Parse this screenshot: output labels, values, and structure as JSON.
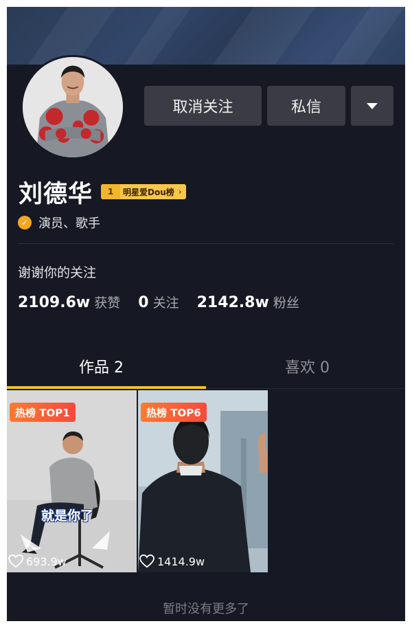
{
  "profile": {
    "name": "刘德华",
    "rank_badge_number": "1",
    "rank_badge_label": "明星爱Dou榜",
    "verified_text": "演员、歌手",
    "bio": "谢谢你的关注"
  },
  "actions": {
    "unfollow_label": "取消关注",
    "message_label": "私信"
  },
  "stats": [
    {
      "value": "2109.6w",
      "label": "获赞"
    },
    {
      "value": "0",
      "label": "关注"
    },
    {
      "value": "2142.8w",
      "label": "粉丝"
    }
  ],
  "tabs": [
    {
      "label": "作品 2",
      "active": true
    },
    {
      "label": "喜欢 0",
      "active": false
    }
  ],
  "videos": [
    {
      "hot_tag": "热榜 TOP1",
      "likes": "693.9w",
      "caption": "就是你了"
    },
    {
      "hot_tag": "热榜 TOP6",
      "likes": "1414.9w",
      "caption": ""
    }
  ],
  "footer": {
    "no_more": "暂时没有更多了"
  },
  "colors": {
    "background": "#161823",
    "button": "#3a3b44",
    "tab_indicator": "#f2c02d",
    "verify": "#f5a623",
    "hot_tag": "#f54a3c"
  },
  "icons": [
    "dropdown-arrow-icon",
    "verified-icon",
    "heart-icon",
    "chevron-right-icon"
  ]
}
